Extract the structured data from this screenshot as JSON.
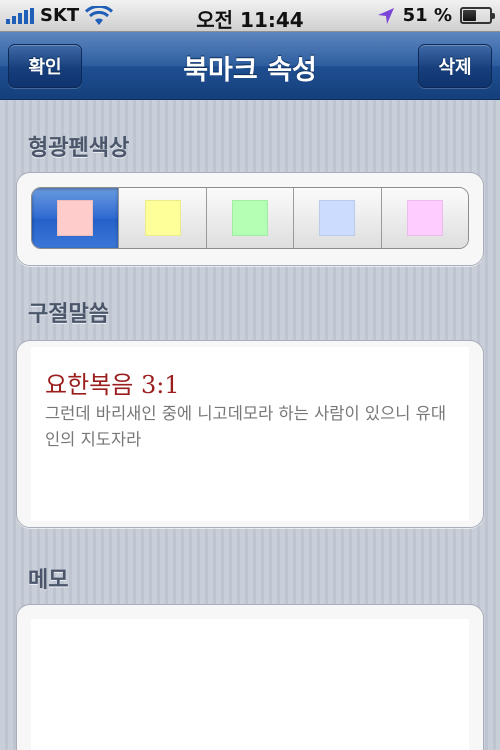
{
  "status_bar": {
    "carrier": "SKT",
    "time": "오전 11:44",
    "battery": "51 %",
    "battery_level": 0.51,
    "signal_bars": 5
  },
  "nav": {
    "left_button": "확인",
    "title": "북마크 속성",
    "right_button": "삭제"
  },
  "highlight": {
    "label": "형광펜색상",
    "selected_index": 0,
    "colors": [
      "#ffcccc",
      "#ffff99",
      "#b3ffb3",
      "#ccdcff",
      "#ffccff"
    ]
  },
  "verse": {
    "label": "구절말씀",
    "reference": "요한복음 3:1",
    "text": "그런데 바리새인 중에 니고데모라 하는 사람이 있으니 유대인의 지도자라"
  },
  "memo": {
    "label": "메모",
    "value": ""
  },
  "colors": {
    "nav_blue": "#1f4f91",
    "verse_ref": "#9b1e1e",
    "segment_selected": "#2f6ad0"
  }
}
